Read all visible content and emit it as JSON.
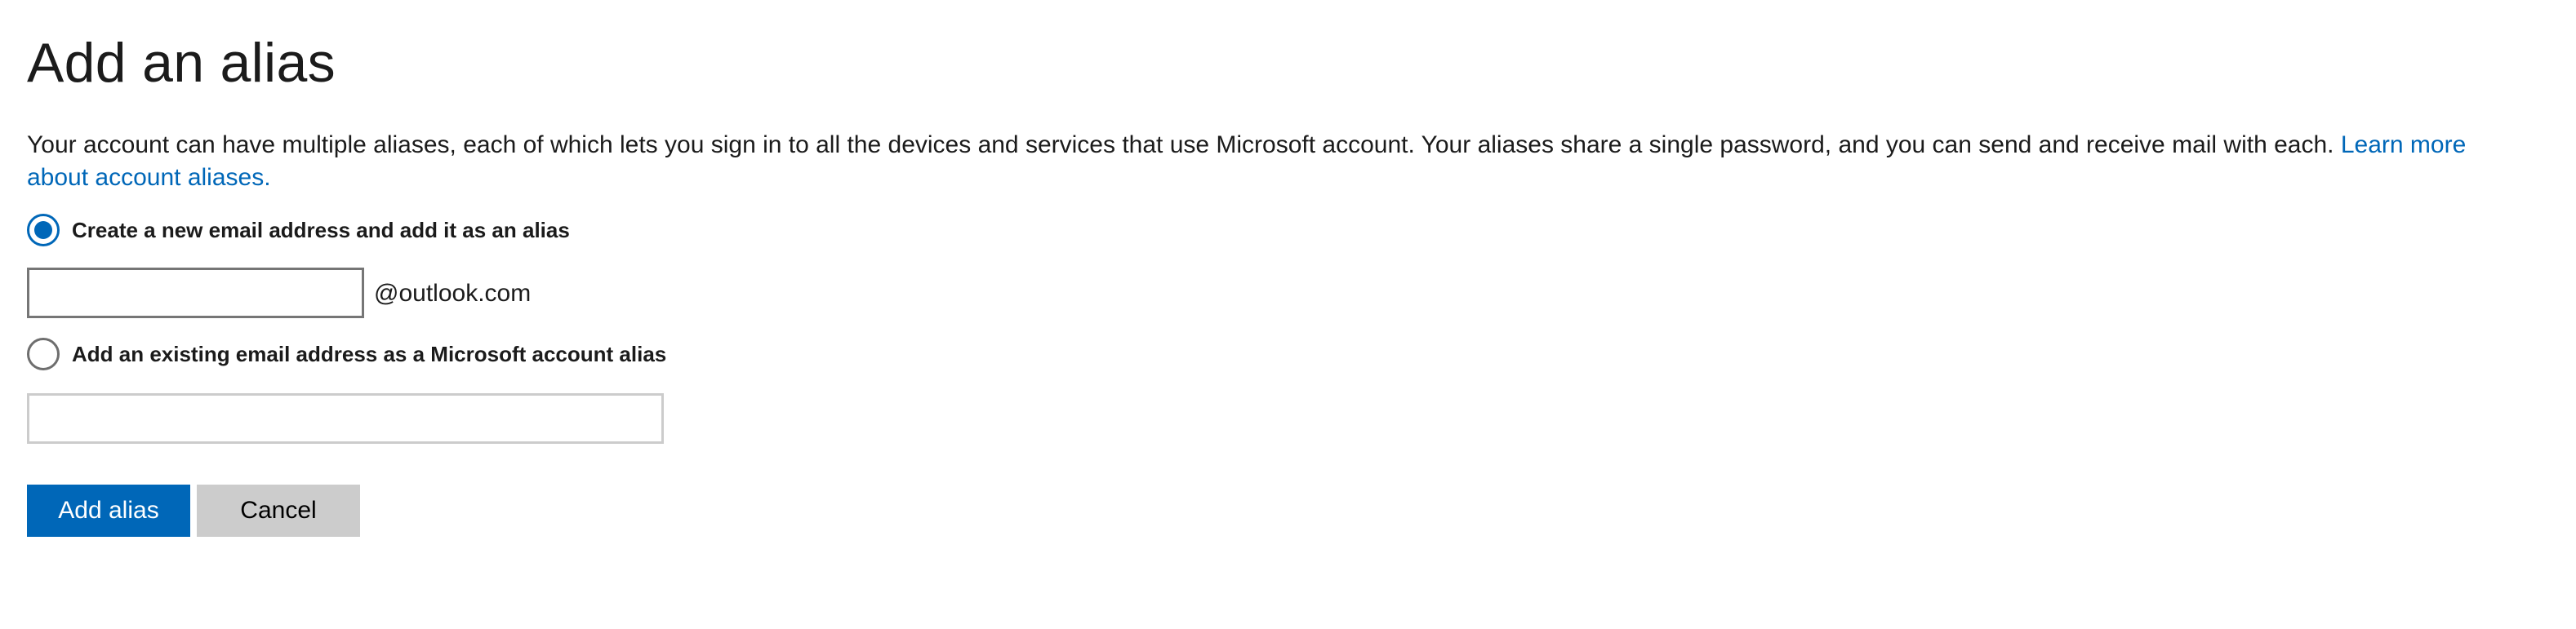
{
  "page": {
    "title": "Add an alias",
    "description": "Your account can have multiple aliases, each of which lets you sign in to all the devices and services that use Microsoft account. Your aliases share a single password, and you can send and receive mail with each.",
    "learn_more_link": "Learn more about account aliases."
  },
  "options": {
    "new_address": {
      "label": "Create a new email address and add it as an alias",
      "selected": true,
      "input_value": "",
      "domain_suffix": "@outlook.com"
    },
    "existing_address": {
      "label": "Add an existing email address as a Microsoft account alias",
      "selected": false,
      "input_value": ""
    }
  },
  "actions": {
    "add_alias_label": "Add alias",
    "cancel_label": "Cancel"
  },
  "colors": {
    "accent": "#0067b8",
    "secondary_button": "#cccccc",
    "text": "#1b1b1b"
  }
}
